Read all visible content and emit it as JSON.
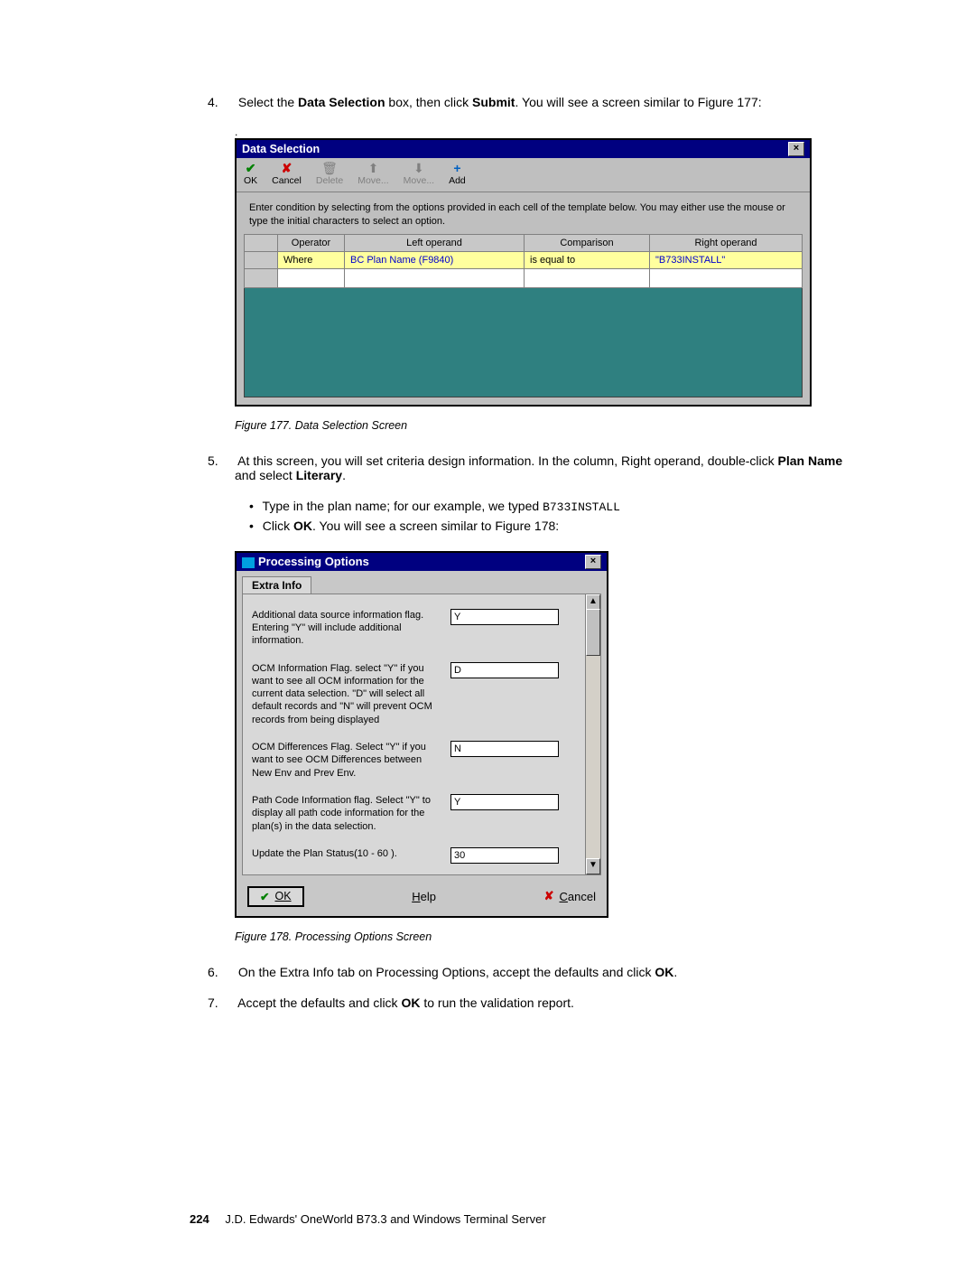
{
  "steps": {
    "s4a": "Select the ",
    "s4b": "Data Selection",
    "s4c": " box, then click ",
    "s4d": "Submit",
    "s4e": ". You will see a screen similar to Figure 177:",
    "s5a": "At this screen, you will set criteria design information. In the column, Right operand, double-click ",
    "s5b": "Plan Name",
    "s5c": " and select ",
    "s5d": "Literary",
    "s5e": ".",
    "s5s1a": "Type in the plan name; for our example, we typed ",
    "s5s1b": "B733INSTALL",
    "s5s2a": "Click ",
    "s5s2b": "OK",
    "s5s2c": ". You will see a screen similar to Figure 178:",
    "s6a": "On the Extra Info tab on Processing Options, accept the defaults and click ",
    "s6b": "OK",
    "s6c": ".",
    "s7": "Accept the defaults and click ",
    "s7b": "OK",
    "s7c": " to run the validation report."
  },
  "nums": {
    "n4": "4.",
    "n5": "5.",
    "n6": "6.",
    "n7": "7."
  },
  "fig177": {
    "caption": "Figure 177.  Data Selection Screen",
    "title": "Data Selection",
    "instr": "Enter condition by selecting from the options provided in each cell of the template below. You may either use the mouse or type the initial characters to select an option.",
    "hdr": {
      "op": "Operator",
      "left": "Left operand",
      "cmp": "Comparison",
      "right": "Right operand"
    },
    "row": {
      "op": "Where",
      "left": "BC Plan Name (F9840)",
      "cmp": "is equal to",
      "right": "\"B733INSTALL\""
    },
    "tb": {
      "ok": "OK",
      "cancel": "Cancel",
      "delete": "Delete",
      "moveu": "Move...",
      "moved": "Move...",
      "add": "Add"
    }
  },
  "fig178": {
    "caption": "Figure 178.  Processing Options Screen",
    "title": "Processing Options",
    "tab": "Extra Info",
    "opts": {
      "r1l": "Additional data source information flag. Entering \"Y\" will include additional information.",
      "r1v": "Y",
      "r2l": "OCM Information Flag.  select \"Y\" if you want to see all OCM information for the current data selection. \"D\" will select all default records and \"N\" will prevent OCM records from being displayed",
      "r2v": "D",
      "r3l": "OCM Differences Flag. Select \"Y\" if you want to see OCM Differences between New Env and Prev Env.",
      "r3v": "N",
      "r4l": "Path Code Information flag.  Select \"Y\" to display all path code information for the plan(s) in the data selection.",
      "r4v": "Y",
      "r5l": "Update the Plan Status(10 - 60 ).",
      "r5v": "30"
    },
    "buttons": {
      "ok": "OK",
      "help": "Help",
      "cancel": "Cancel"
    }
  },
  "footer": {
    "page": "224",
    "text": "J.D. Edwards' OneWorld B73.3 and Windows Terminal Server"
  }
}
